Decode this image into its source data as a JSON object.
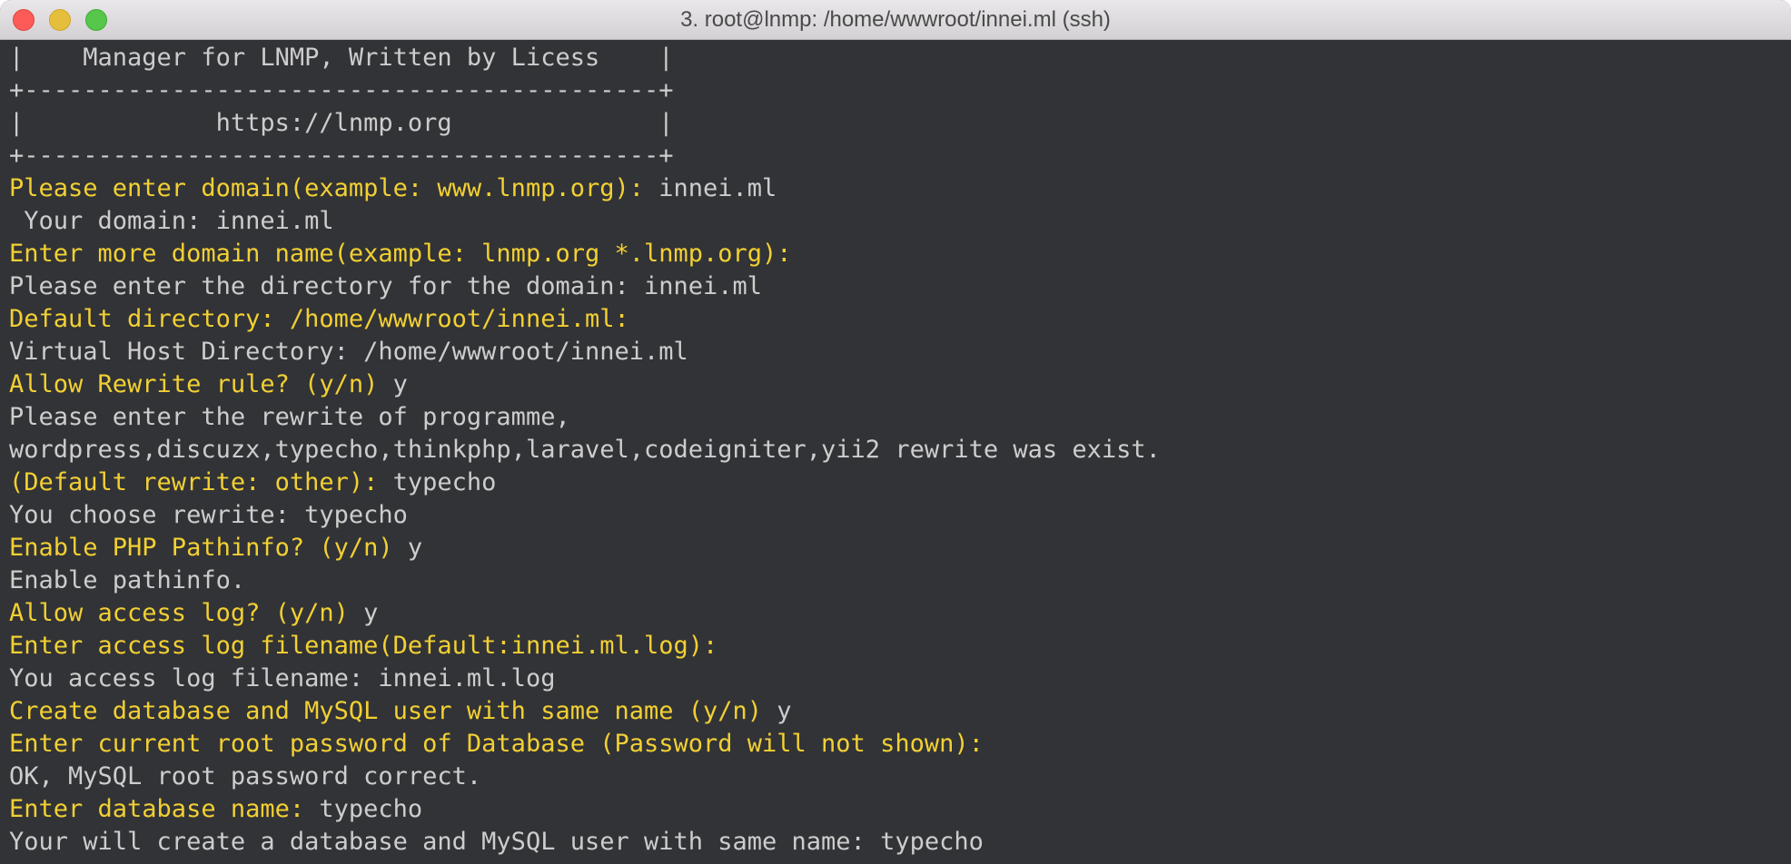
{
  "window": {
    "title": "3. root@lnmp: /home/wwwroot/innei.ml (ssh)"
  },
  "terminal": {
    "lines": [
      {
        "prompt": "",
        "text": "|    Manager for LNMP, Written by Licess    |"
      },
      {
        "prompt": "",
        "text": "+-------------------------------------------+"
      },
      {
        "prompt": "",
        "text": "|             https://lnmp.org              |"
      },
      {
        "prompt": "",
        "text": "+-------------------------------------------+"
      },
      {
        "prompt": "Please enter domain(example: www.lnmp.org):",
        "text": " innei.ml"
      },
      {
        "prompt": "",
        "text": " Your domain: innei.ml"
      },
      {
        "prompt": "Enter more domain name(example: lnmp.org *.lnmp.org):",
        "text": ""
      },
      {
        "prompt": "",
        "text": "Please enter the directory for the domain: innei.ml"
      },
      {
        "prompt": "Default directory: /home/wwwroot/innei.ml:",
        "text": ""
      },
      {
        "prompt": "",
        "text": "Virtual Host Directory: /home/wwwroot/innei.ml"
      },
      {
        "prompt": "Allow Rewrite rule? (y/n)",
        "text": " y"
      },
      {
        "prompt": "",
        "text": "Please enter the rewrite of programme,"
      },
      {
        "prompt": "",
        "text": "wordpress,discuzx,typecho,thinkphp,laravel,codeigniter,yii2 rewrite was exist."
      },
      {
        "prompt": "(Default rewrite: other):",
        "text": " typecho"
      },
      {
        "prompt": "",
        "text": "You choose rewrite: typecho"
      },
      {
        "prompt": "Enable PHP Pathinfo? (y/n)",
        "text": " y"
      },
      {
        "prompt": "",
        "text": "Enable pathinfo."
      },
      {
        "prompt": "Allow access log? (y/n)",
        "text": " y"
      },
      {
        "prompt": "Enter access log filename(Default:innei.ml.log):",
        "text": ""
      },
      {
        "prompt": "",
        "text": "You access log filename: innei.ml.log"
      },
      {
        "prompt": "Create database and MySQL user with same name (y/n)",
        "text": " y"
      },
      {
        "prompt": "Enter current root password of Database (Password will not shown):",
        "text": ""
      },
      {
        "prompt": "",
        "text": "OK, MySQL root password correct."
      },
      {
        "prompt": "Enter database name:",
        "text": " typecho"
      },
      {
        "prompt": "",
        "text": "Your will create a database and MySQL user with same name: typecho"
      }
    ]
  },
  "colors": {
    "background": "#323336",
    "prompt": "#f2d033",
    "text": "#cdcdcd"
  }
}
